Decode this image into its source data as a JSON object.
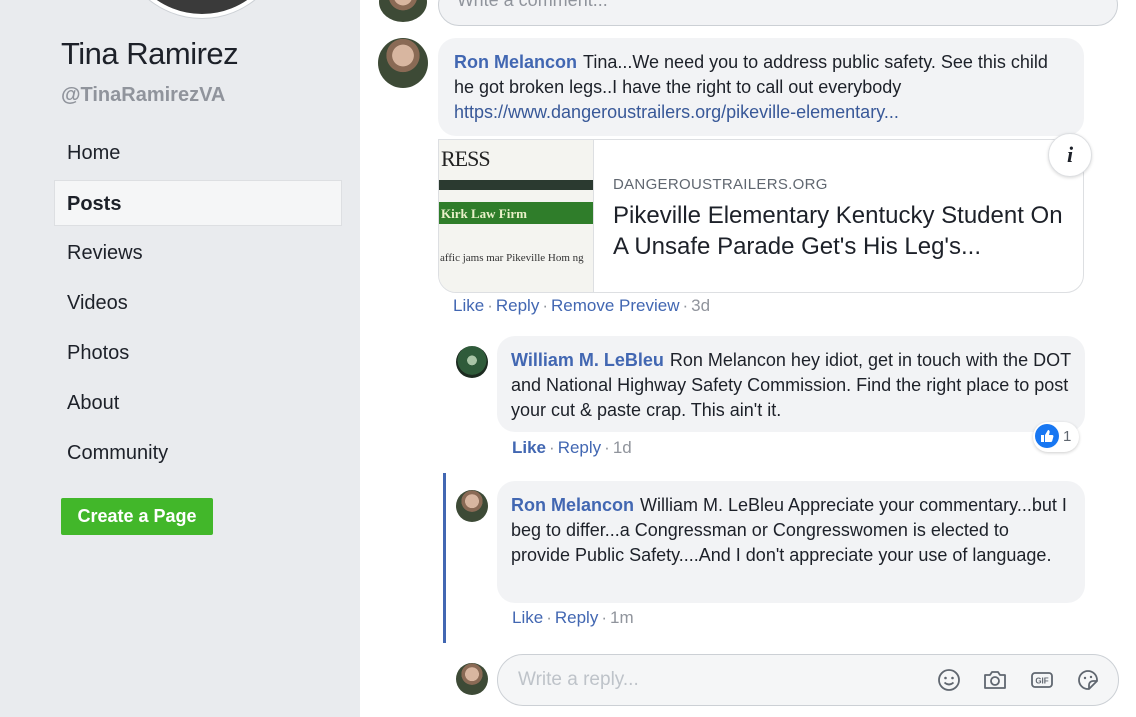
{
  "sidebar": {
    "page_name": "Tina Ramirez",
    "handle": "@TinaRamirezVA",
    "nav": [
      {
        "label": "Home"
      },
      {
        "label": "Posts",
        "active": true
      },
      {
        "label": "Reviews"
      },
      {
        "label": "Videos"
      },
      {
        "label": "Photos"
      },
      {
        "label": "About"
      },
      {
        "label": "Community"
      }
    ],
    "create_page_label": "Create a Page"
  },
  "top_comment_input": {
    "placeholder": "Write a comment..."
  },
  "comment": {
    "author": "Ron Melancon",
    "text": "Tina...We need you to address public safety. See this child he got broken legs..I have the right to call out everybody",
    "link": "https://www.dangeroustrailers.org/pikeville-elementary...",
    "preview": {
      "thumb_masthead": "RESS",
      "thumb_firm": "Kirk Law Firm",
      "thumb_caption": "affic jams mar Pikeville Hom ng",
      "domain": "DANGEROUSTRAILERS.ORG",
      "title": "Pikeville Elementary Kentucky Student On A Unsafe Parade Get's His Leg's..."
    },
    "actions": {
      "like": "Like",
      "reply": "Reply",
      "remove_preview": "Remove Preview",
      "time": "3d"
    }
  },
  "replies": [
    {
      "author": "William M. LeBleu",
      "text": "Ron Melancon hey idiot, get in touch with the DOT and National Highway Safety Commission. Find the right place to post your cut & paste crap. This ain't it.",
      "like": "Like",
      "reply": "Reply",
      "time": "1d",
      "reaction_count": "1"
    },
    {
      "author": "Ron Melancon",
      "text": "William M. LeBleu Appreciate your commentary...but I beg to differ...a Congressman or Congresswomen is elected to provide Public Safety....And I don't appreciate your use of language.",
      "like": "Like",
      "reply": "Reply",
      "time": "1m"
    }
  ],
  "reply_input": {
    "placeholder": "Write a reply...",
    "icons": [
      "emoji-icon",
      "camera-icon",
      "gif-icon",
      "sticker-icon"
    ]
  },
  "colors": {
    "link_blue": "#4267b2",
    "create_green": "#42b72a",
    "like_blue": "#1877f2"
  }
}
